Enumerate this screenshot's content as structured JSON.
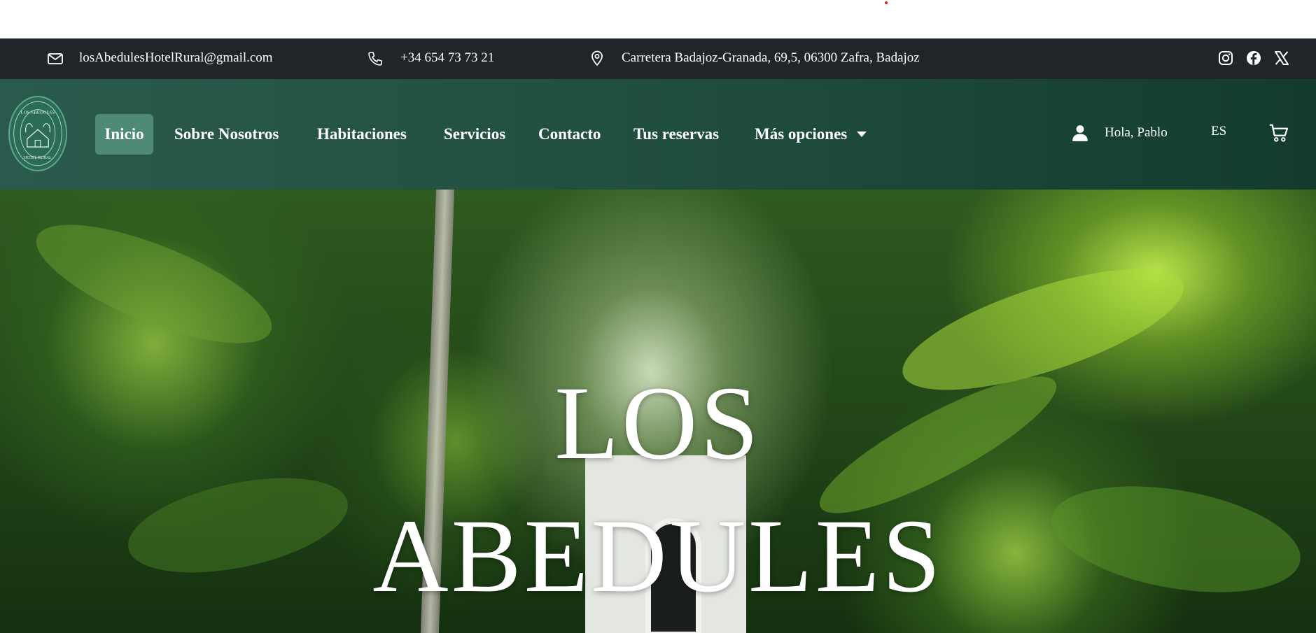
{
  "topbar": {
    "email": "losAbedulesHotelRural@gmail.com",
    "phone": "+34 654 73 73 21",
    "address": "Carretera Badajoz-Granada, 69,5, 06300 Zafra, Badajoz",
    "icons": [
      "envelope-icon",
      "phone-icon",
      "map-pin-icon",
      "instagram-icon",
      "facebook-icon",
      "x-icon"
    ]
  },
  "logo": {
    "top_text": "LOS ABEDULES",
    "bottom_text": "HOTEL RURAL"
  },
  "nav": {
    "items": [
      {
        "label": "Inicio",
        "active": true
      },
      {
        "label": "Sobre Nosotros"
      },
      {
        "label": "Habitaciones"
      },
      {
        "label": "Servicios"
      },
      {
        "label": "Contacto"
      },
      {
        "label": "Tus reservas"
      },
      {
        "label": "Más opciones"
      }
    ],
    "greeting": "Hola, Pablo",
    "language": "ES"
  },
  "hero": {
    "line1": "LOS",
    "line2": "ABEDULES"
  },
  "colors": {
    "topbar_bg": "#212529",
    "navbar_bg": "#22503f",
    "active_bg": "#4e8a76",
    "accent_dot": "#d9201c"
  }
}
